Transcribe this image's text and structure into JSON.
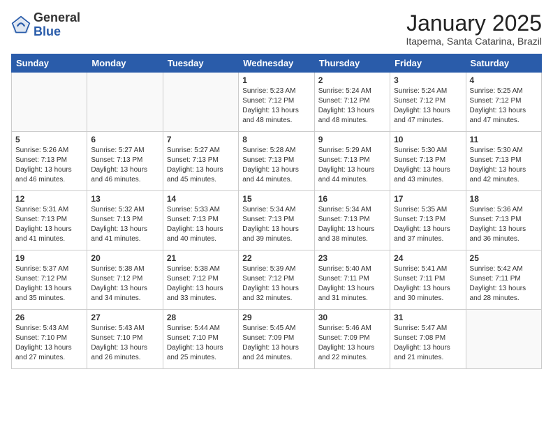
{
  "header": {
    "logo_general": "General",
    "logo_blue": "Blue",
    "title": "January 2025",
    "subtitle": "Itapema, Santa Catarina, Brazil"
  },
  "weekdays": [
    "Sunday",
    "Monday",
    "Tuesday",
    "Wednesday",
    "Thursday",
    "Friday",
    "Saturday"
  ],
  "weeks": [
    [
      {
        "day": "",
        "info": ""
      },
      {
        "day": "",
        "info": ""
      },
      {
        "day": "",
        "info": ""
      },
      {
        "day": "1",
        "info": "Sunrise: 5:23 AM\nSunset: 7:12 PM\nDaylight: 13 hours\nand 48 minutes."
      },
      {
        "day": "2",
        "info": "Sunrise: 5:24 AM\nSunset: 7:12 PM\nDaylight: 13 hours\nand 48 minutes."
      },
      {
        "day": "3",
        "info": "Sunrise: 5:24 AM\nSunset: 7:12 PM\nDaylight: 13 hours\nand 47 minutes."
      },
      {
        "day": "4",
        "info": "Sunrise: 5:25 AM\nSunset: 7:12 PM\nDaylight: 13 hours\nand 47 minutes."
      }
    ],
    [
      {
        "day": "5",
        "info": "Sunrise: 5:26 AM\nSunset: 7:13 PM\nDaylight: 13 hours\nand 46 minutes."
      },
      {
        "day": "6",
        "info": "Sunrise: 5:27 AM\nSunset: 7:13 PM\nDaylight: 13 hours\nand 46 minutes."
      },
      {
        "day": "7",
        "info": "Sunrise: 5:27 AM\nSunset: 7:13 PM\nDaylight: 13 hours\nand 45 minutes."
      },
      {
        "day": "8",
        "info": "Sunrise: 5:28 AM\nSunset: 7:13 PM\nDaylight: 13 hours\nand 44 minutes."
      },
      {
        "day": "9",
        "info": "Sunrise: 5:29 AM\nSunset: 7:13 PM\nDaylight: 13 hours\nand 44 minutes."
      },
      {
        "day": "10",
        "info": "Sunrise: 5:30 AM\nSunset: 7:13 PM\nDaylight: 13 hours\nand 43 minutes."
      },
      {
        "day": "11",
        "info": "Sunrise: 5:30 AM\nSunset: 7:13 PM\nDaylight: 13 hours\nand 42 minutes."
      }
    ],
    [
      {
        "day": "12",
        "info": "Sunrise: 5:31 AM\nSunset: 7:13 PM\nDaylight: 13 hours\nand 41 minutes."
      },
      {
        "day": "13",
        "info": "Sunrise: 5:32 AM\nSunset: 7:13 PM\nDaylight: 13 hours\nand 41 minutes."
      },
      {
        "day": "14",
        "info": "Sunrise: 5:33 AM\nSunset: 7:13 PM\nDaylight: 13 hours\nand 40 minutes."
      },
      {
        "day": "15",
        "info": "Sunrise: 5:34 AM\nSunset: 7:13 PM\nDaylight: 13 hours\nand 39 minutes."
      },
      {
        "day": "16",
        "info": "Sunrise: 5:34 AM\nSunset: 7:13 PM\nDaylight: 13 hours\nand 38 minutes."
      },
      {
        "day": "17",
        "info": "Sunrise: 5:35 AM\nSunset: 7:13 PM\nDaylight: 13 hours\nand 37 minutes."
      },
      {
        "day": "18",
        "info": "Sunrise: 5:36 AM\nSunset: 7:13 PM\nDaylight: 13 hours\nand 36 minutes."
      }
    ],
    [
      {
        "day": "19",
        "info": "Sunrise: 5:37 AM\nSunset: 7:12 PM\nDaylight: 13 hours\nand 35 minutes."
      },
      {
        "day": "20",
        "info": "Sunrise: 5:38 AM\nSunset: 7:12 PM\nDaylight: 13 hours\nand 34 minutes."
      },
      {
        "day": "21",
        "info": "Sunrise: 5:38 AM\nSunset: 7:12 PM\nDaylight: 13 hours\nand 33 minutes."
      },
      {
        "day": "22",
        "info": "Sunrise: 5:39 AM\nSunset: 7:12 PM\nDaylight: 13 hours\nand 32 minutes."
      },
      {
        "day": "23",
        "info": "Sunrise: 5:40 AM\nSunset: 7:11 PM\nDaylight: 13 hours\nand 31 minutes."
      },
      {
        "day": "24",
        "info": "Sunrise: 5:41 AM\nSunset: 7:11 PM\nDaylight: 13 hours\nand 30 minutes."
      },
      {
        "day": "25",
        "info": "Sunrise: 5:42 AM\nSunset: 7:11 PM\nDaylight: 13 hours\nand 28 minutes."
      }
    ],
    [
      {
        "day": "26",
        "info": "Sunrise: 5:43 AM\nSunset: 7:10 PM\nDaylight: 13 hours\nand 27 minutes."
      },
      {
        "day": "27",
        "info": "Sunrise: 5:43 AM\nSunset: 7:10 PM\nDaylight: 13 hours\nand 26 minutes."
      },
      {
        "day": "28",
        "info": "Sunrise: 5:44 AM\nSunset: 7:10 PM\nDaylight: 13 hours\nand 25 minutes."
      },
      {
        "day": "29",
        "info": "Sunrise: 5:45 AM\nSunset: 7:09 PM\nDaylight: 13 hours\nand 24 minutes."
      },
      {
        "day": "30",
        "info": "Sunrise: 5:46 AM\nSunset: 7:09 PM\nDaylight: 13 hours\nand 22 minutes."
      },
      {
        "day": "31",
        "info": "Sunrise: 5:47 AM\nSunset: 7:08 PM\nDaylight: 13 hours\nand 21 minutes."
      },
      {
        "day": "",
        "info": ""
      }
    ]
  ]
}
